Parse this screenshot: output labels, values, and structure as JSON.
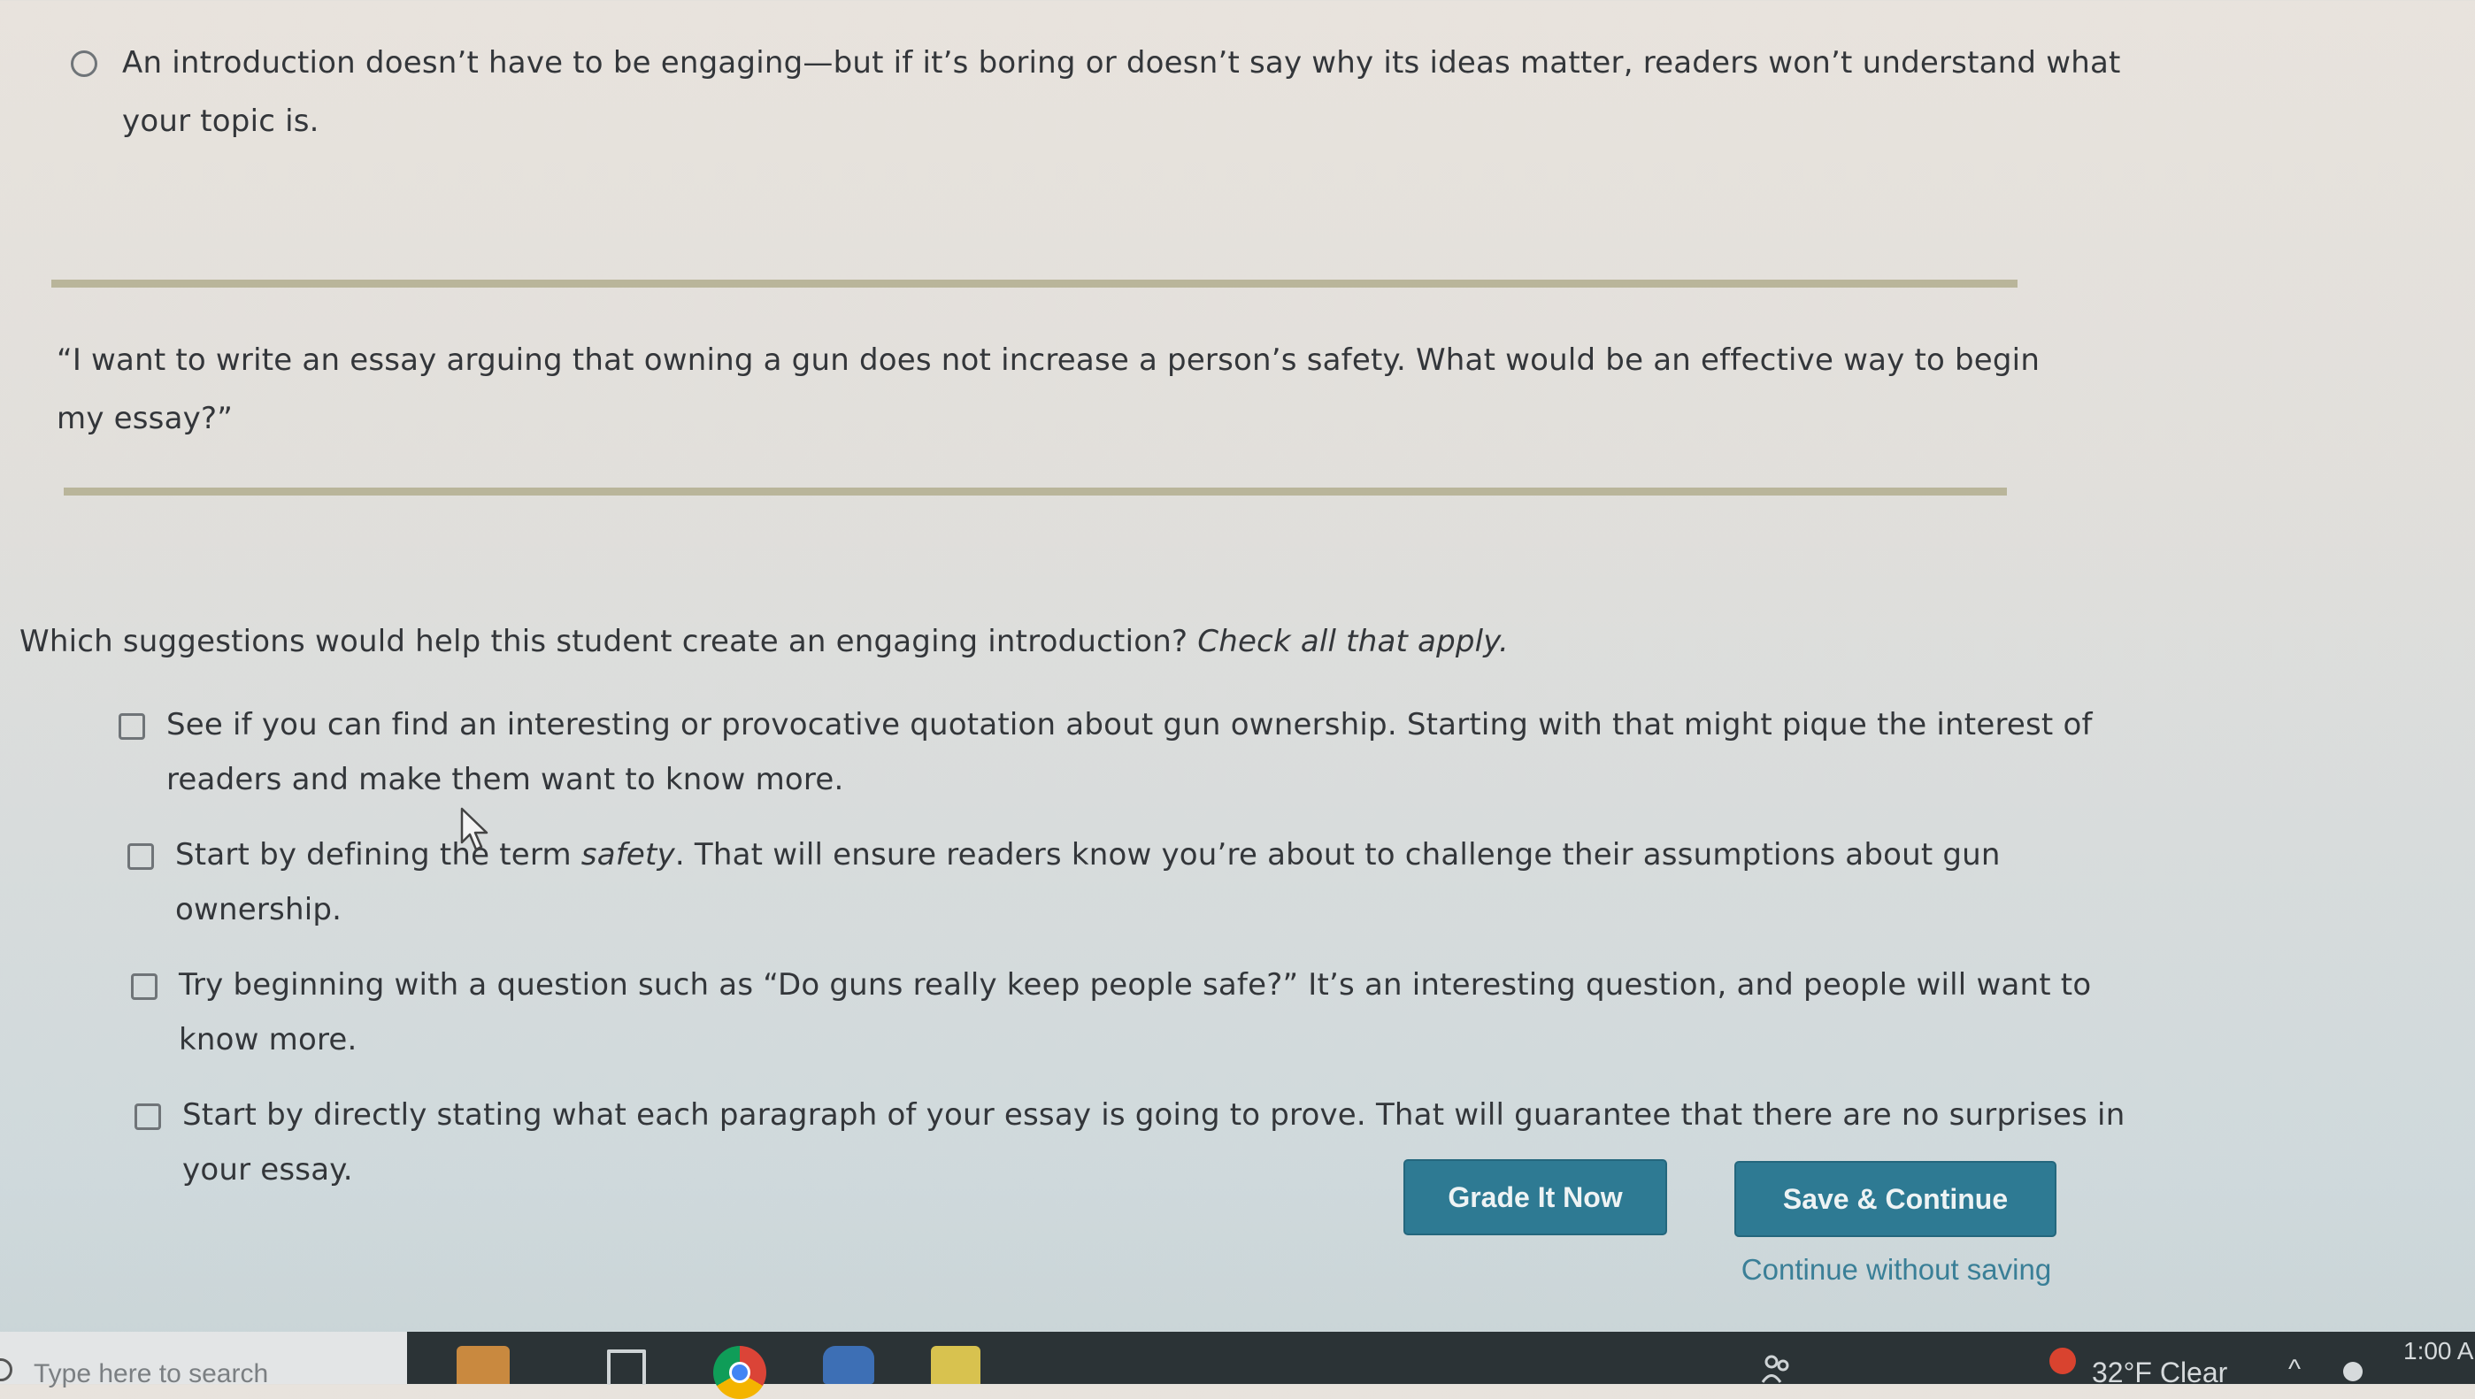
{
  "previous_option": {
    "text": "An introduction doesn’t have to be engaging—but if it’s boring or doesn’t say why its ideas matter, readers won’t understand what your topic is."
  },
  "scenario": {
    "quote": "“I want to write an essay arguing that owning a gun does not increase a person’s safety. What would be an effective way to begin my essay?”"
  },
  "question": {
    "text": "Which suggestions would help this student create an engaging introduction?",
    "instruction": "Check all that apply."
  },
  "options": [
    {
      "text": "See if you can find an interesting or provocative quotation about gun ownership. Starting with that might pique the interest of readers and make them want to know more.",
      "checked": false
    },
    {
      "text_before": "Start by defining the term ",
      "text_em": "safety",
      "text_after": ". That will ensure readers know you’re about to challenge their assumptions about gun ownership.",
      "checked": false
    },
    {
      "text": "Try beginning with a question such as “Do guns really keep people safe?” It’s an interesting question, and people will want to know more.",
      "checked": false
    },
    {
      "text": "Start by directly stating what each paragraph of your essay is going to prove. That will guarantee that there are no surprises in your essay.",
      "checked": false
    }
  ],
  "buttons": {
    "grade": "Grade It Now",
    "save": "Save & Continue",
    "continue_without_saving": "Continue without saving"
  },
  "taskbar": {
    "search_placeholder": "Type here to search",
    "weather": "32°F  Clear",
    "chevron": "^",
    "clock": "1:00 A"
  },
  "colors": {
    "button_bg": "#2e7a93",
    "link": "#3a7f97",
    "rule": "#b9b59a",
    "taskbar": "#2b3336"
  }
}
